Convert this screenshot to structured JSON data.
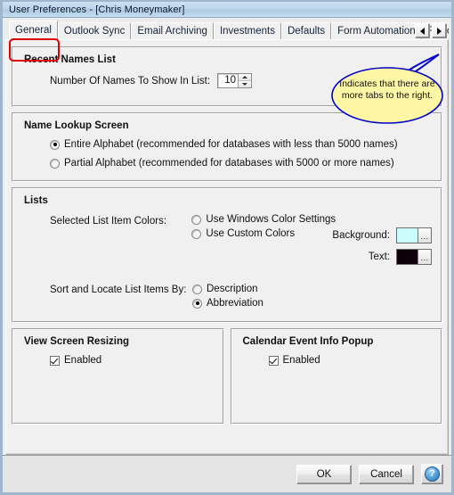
{
  "window": {
    "title": "User Preferences -  [Chris Moneymaker]"
  },
  "tabs": [
    {
      "label": "General",
      "active": true
    },
    {
      "label": "Outlook Sync",
      "active": false
    },
    {
      "label": "Email Archiving",
      "active": false
    },
    {
      "label": "Investments",
      "active": false
    },
    {
      "label": "Defaults",
      "active": false
    },
    {
      "label": "Form Automation",
      "active": false
    },
    {
      "label": "Report",
      "active": false
    }
  ],
  "tab_scroll": {
    "left_icon": "triangle-left-icon",
    "right_icon": "triangle-right-icon"
  },
  "annotations": {
    "general_highlight_color": "#e00000",
    "callout": {
      "text": "Indicates that there are more tabs to the right.",
      "fill": "#fdf6a5",
      "stroke": "#0000cc"
    }
  },
  "groups": {
    "recent_names": {
      "title": "Recent Names List",
      "number_label": "Number Of Names To Show In List:",
      "number_value": "10"
    },
    "name_lookup": {
      "title": "Name Lookup Screen",
      "options": [
        {
          "label": "Entire Alphabet (recommended for databases with less than 5000 names)",
          "selected": true
        },
        {
          "label": "Partial Alphabet (recommended for databases with 5000 or more names)",
          "selected": false
        }
      ]
    },
    "lists": {
      "title": "Lists",
      "colors_label": "Selected List Item Colors:",
      "color_options": [
        {
          "label": "Use Windows Color Settings",
          "selected": false
        },
        {
          "label": "Use Custom Colors",
          "selected": false
        }
      ],
      "background_label": "Background:",
      "background_color": "#ccfbfb",
      "text_label": "Text:",
      "text_color": "#0d0008",
      "ellipsis_label": "...",
      "sort_label": "Sort and Locate List Items By:",
      "sort_options": [
        {
          "label": "Description",
          "selected": false
        },
        {
          "label": "Abbreviation",
          "selected": true
        }
      ]
    },
    "view_screen_resizing": {
      "title": "View Screen Resizing",
      "enabled_label": "Enabled",
      "enabled": true
    },
    "calendar_event_popup": {
      "title": "Calendar Event Info Popup",
      "enabled_label": "Enabled",
      "enabled": true
    }
  },
  "footer": {
    "ok_label": "OK",
    "cancel_label": "Cancel",
    "help_label": "?"
  }
}
